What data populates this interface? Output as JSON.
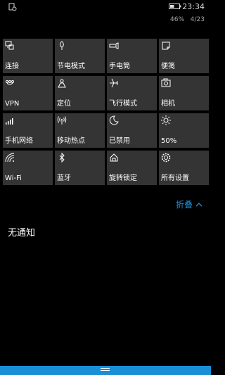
{
  "status_bar": {
    "time": "23:34",
    "battery_percent": "46%",
    "date": "4/23",
    "battery_level": 0.46
  },
  "quick_actions": [
    {
      "label": "连接",
      "icon": "project-connect-icon"
    },
    {
      "label": "节电模式",
      "icon": "battery-saver-icon"
    },
    {
      "label": "手电筒",
      "icon": "flashlight-icon"
    },
    {
      "label": "便笺",
      "icon": "note-icon"
    },
    {
      "label": "VPN",
      "icon": "vpn-icon"
    },
    {
      "label": "定位",
      "icon": "location-icon"
    },
    {
      "label": "飞行模式",
      "icon": "airplane-icon"
    },
    {
      "label": "相机",
      "icon": "camera-icon"
    },
    {
      "label": "手机网络",
      "icon": "cellular-icon"
    },
    {
      "label": "移动热点",
      "icon": "hotspot-icon"
    },
    {
      "label": "已禁用",
      "icon": "quiet-hours-icon"
    },
    {
      "label": "50%",
      "icon": "brightness-icon"
    },
    {
      "label": "Wi-Fi",
      "icon": "wifi-icon"
    },
    {
      "label": "蓝牙",
      "icon": "bluetooth-icon"
    },
    {
      "label": "旋转锁定",
      "icon": "rotation-lock-icon"
    },
    {
      "label": "所有设置",
      "icon": "settings-icon"
    }
  ],
  "collapse_label": "折叠",
  "no_notifications": "无通知",
  "colors": {
    "accent": "#1e90d8",
    "tile": "#343434",
    "background": "#000000"
  }
}
